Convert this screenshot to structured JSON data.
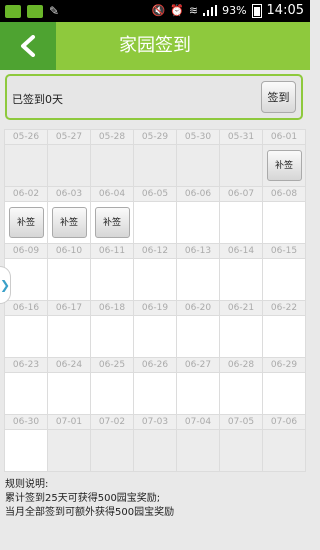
{
  "status_bar": {
    "battery": "93%",
    "time": "14:05"
  },
  "header": {
    "title": "家园签到",
    "back_icon": "back-arrow-icon"
  },
  "checkin": {
    "status_text": "已签到0天",
    "button_label": "签到"
  },
  "calendar": {
    "makeup_label": "补签",
    "weeks": [
      {
        "dates": [
          "05-26",
          "05-27",
          "05-28",
          "05-29",
          "05-30",
          "05-31",
          "06-01"
        ],
        "makeup": [
          false,
          false,
          false,
          false,
          false,
          false,
          true
        ],
        "past": [
          true,
          true,
          true,
          true,
          true,
          true,
          true
        ]
      },
      {
        "dates": [
          "06-02",
          "06-03",
          "06-04",
          "06-05",
          "06-06",
          "06-07",
          "06-08"
        ],
        "makeup": [
          true,
          true,
          true,
          false,
          false,
          false,
          false
        ],
        "past": [
          false,
          false,
          false,
          false,
          false,
          false,
          false
        ]
      },
      {
        "dates": [
          "06-09",
          "06-10",
          "06-11",
          "06-12",
          "06-13",
          "06-14",
          "06-15"
        ],
        "makeup": [
          false,
          false,
          false,
          false,
          false,
          false,
          false
        ],
        "past": [
          false,
          false,
          false,
          false,
          false,
          false,
          false
        ]
      },
      {
        "dates": [
          "06-16",
          "06-17",
          "06-18",
          "06-19",
          "06-20",
          "06-21",
          "06-22"
        ],
        "makeup": [
          false,
          false,
          false,
          false,
          false,
          false,
          false
        ],
        "past": [
          false,
          false,
          false,
          false,
          false,
          false,
          false
        ]
      },
      {
        "dates": [
          "06-23",
          "06-24",
          "06-25",
          "06-26",
          "06-27",
          "06-28",
          "06-29"
        ],
        "makeup": [
          false,
          false,
          false,
          false,
          false,
          false,
          false
        ],
        "past": [
          false,
          false,
          false,
          false,
          false,
          false,
          false
        ]
      },
      {
        "dates": [
          "06-30",
          "07-01",
          "07-02",
          "07-03",
          "07-04",
          "07-05",
          "07-06"
        ],
        "makeup": [
          false,
          false,
          false,
          false,
          false,
          false,
          false
        ],
        "past": [
          false,
          true,
          true,
          true,
          true,
          true,
          true
        ]
      }
    ]
  },
  "rules": {
    "title": "规则说明:",
    "lines": [
      "累计签到25天可获得500园宝奖励;",
      "当月全部签到可额外获得500园宝奖励"
    ]
  }
}
